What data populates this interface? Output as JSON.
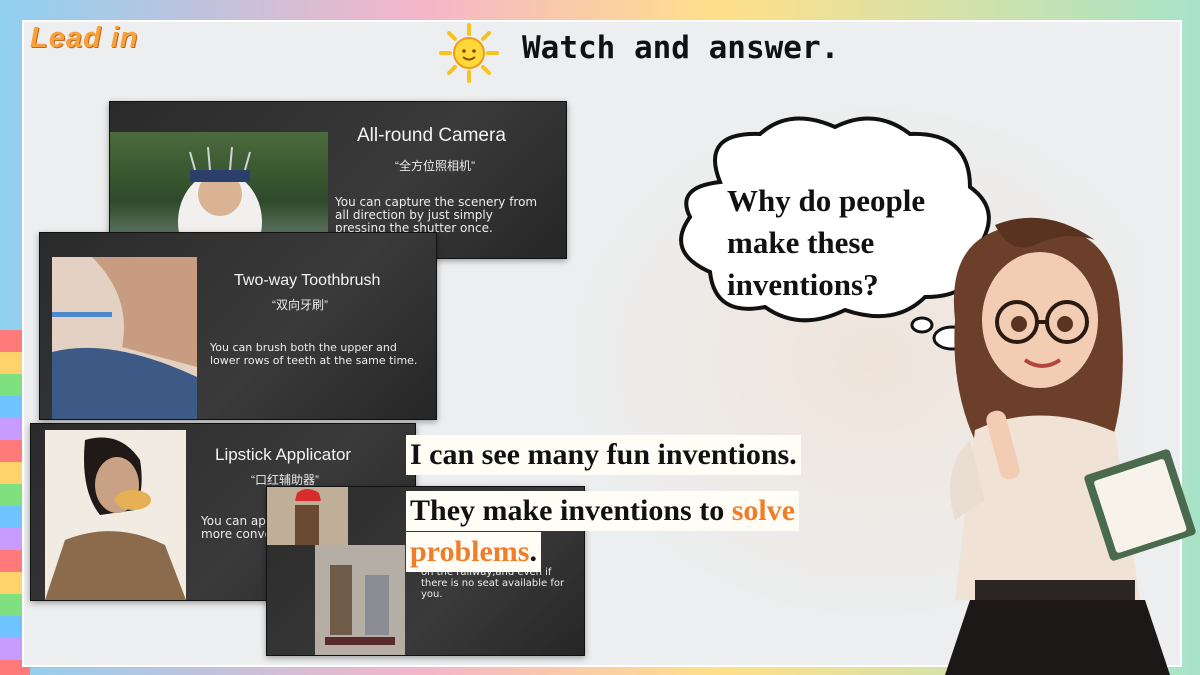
{
  "header": {
    "section": "Lead in",
    "title": "Watch and answer."
  },
  "cards": [
    {
      "title": "All-round Camera",
      "cn": "“全方位照相机”",
      "desc_lines": [
        "You can capture the scenery from",
        "all direction by just simply",
        "pressing the shutter once."
      ]
    },
    {
      "title": "Two-way Toothbrush",
      "cn": "“双向牙刷”",
      "desc_lines": [
        "You can brush both the upper and",
        "lower rows of teeth at the same time."
      ]
    },
    {
      "title": "Lipstick Applicator",
      "cn": "“口红辅助器”",
      "desc_lines": [
        "You can ap",
        "more conve"
      ]
    },
    {
      "title": "",
      "cn": "",
      "desc_lines": [
        "on the railway,and even if",
        "there is no seat available for you."
      ]
    }
  ],
  "bubble": {
    "lines": [
      "Why do people",
      "make these",
      "inventions?"
    ]
  },
  "statements": {
    "line1": "I can see many fun inventions.",
    "line2_prefix": "They make inventions to ",
    "line2_highlight": "solve",
    "line3_highlight": "problems",
    "line3_suffix": "."
  },
  "colors": {
    "accent_orange": "#ef7d2a",
    "lead_in": "#f7a13a"
  }
}
